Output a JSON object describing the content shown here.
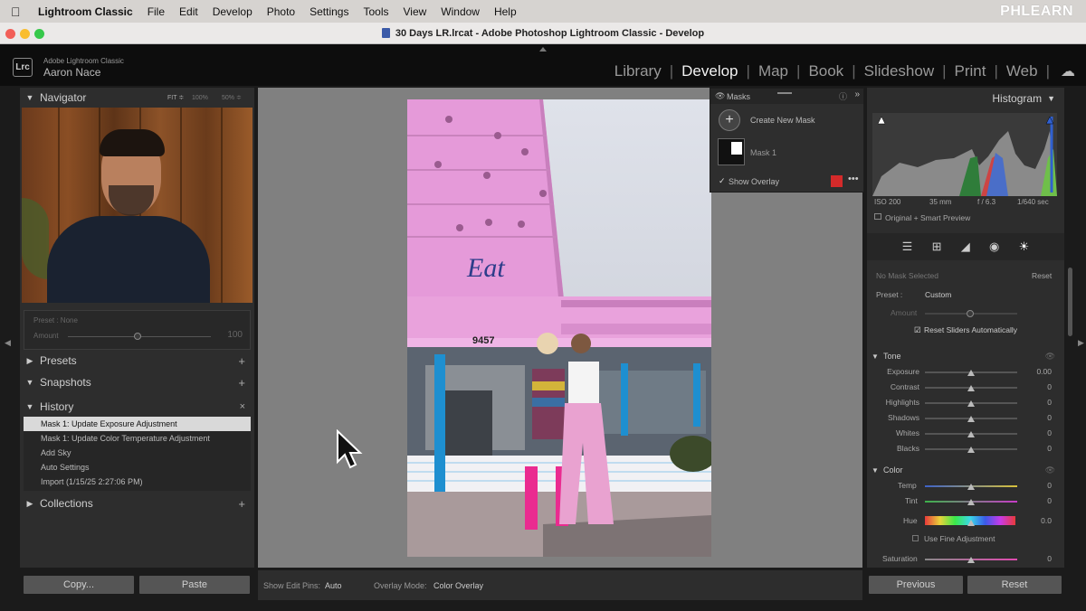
{
  "menubar": {
    "apple": "",
    "items": [
      "Lightroom Classic",
      "File",
      "Edit",
      "Develop",
      "Photo",
      "Settings",
      "Tools",
      "View",
      "Window",
      "Help"
    ],
    "brand": "PHLEARN"
  },
  "window": {
    "title": "30 Days LR.lrcat - Adobe Photoshop Lightroom Classic - Develop"
  },
  "identity": {
    "logo": "Lrc",
    "app_name": "Adobe Lightroom Classic",
    "user": "Aaron Nace",
    "modules": [
      "Library",
      "Develop",
      "Map",
      "Book",
      "Slideshow",
      "Print",
      "Web"
    ],
    "active_module": "Develop"
  },
  "left_panel": {
    "navigator": {
      "title": "Navigator",
      "zoom_options": [
        "FIT ≑",
        "100%",
        "50% ≑"
      ]
    },
    "preset": {
      "label": "Preset : None",
      "amount_label": "Amount",
      "amount_value": "100"
    },
    "presets": {
      "title": "Presets"
    },
    "snapshots": {
      "title": "Snapshots"
    },
    "history": {
      "title": "History",
      "items": [
        "Mask 1: Update Exposure Adjustment",
        "Mask 1: Update Color Temperature Adjustment",
        "Add Sky",
        "Auto Settings",
        "Import (1/15/25 2:27:06 PM)"
      ]
    },
    "collections": {
      "title": "Collections"
    },
    "buttons": {
      "copy": "Copy...",
      "paste": "Paste"
    }
  },
  "center": {
    "photo_sign_number": "9457",
    "photo_sign_text": "Eat",
    "toolbar": {
      "edit_pins_label": "Show Edit Pins:",
      "edit_pins_value": "Auto",
      "overlay_mode_label": "Overlay Mode:",
      "overlay_mode_value": "Color Overlay"
    }
  },
  "masks": {
    "title": "Masks",
    "create_new": "Create New Mask",
    "mask_name": "Mask 1",
    "show_overlay": "Show Overlay",
    "overlay_color": "#d42a2a"
  },
  "right_panel": {
    "histogram": {
      "title": "Histogram",
      "iso": "ISO 200",
      "focal": "35 mm",
      "aperture": "f / 6.3",
      "shutter": "1/640 sec",
      "preview": "Original + Smart Preview"
    },
    "mask_status": "No Mask Selected",
    "reset_label": "Reset",
    "preset_label": "Preset :",
    "preset_value": "Custom",
    "amount_label": "Amount",
    "reset_sliders": "Reset Sliders Automatically",
    "tone": {
      "title": "Tone",
      "sliders": [
        {
          "label": "Exposure",
          "value": "0.00"
        },
        {
          "label": "Contrast",
          "value": "0"
        },
        {
          "label": "Highlights",
          "value": "0"
        },
        {
          "label": "Shadows",
          "value": "0"
        },
        {
          "label": "Whites",
          "value": "0"
        },
        {
          "label": "Blacks",
          "value": "0"
        }
      ]
    },
    "color": {
      "title": "Color",
      "temp": {
        "label": "Temp",
        "value": "0"
      },
      "tint": {
        "label": "Tint",
        "value": "0"
      },
      "hue": {
        "label": "Hue",
        "value": "0.0"
      },
      "fine_adjustment": "Use Fine Adjustment",
      "saturation": {
        "label": "Saturation",
        "value": "0"
      }
    },
    "buttons": {
      "previous": "Previous",
      "reset": "Reset"
    }
  }
}
